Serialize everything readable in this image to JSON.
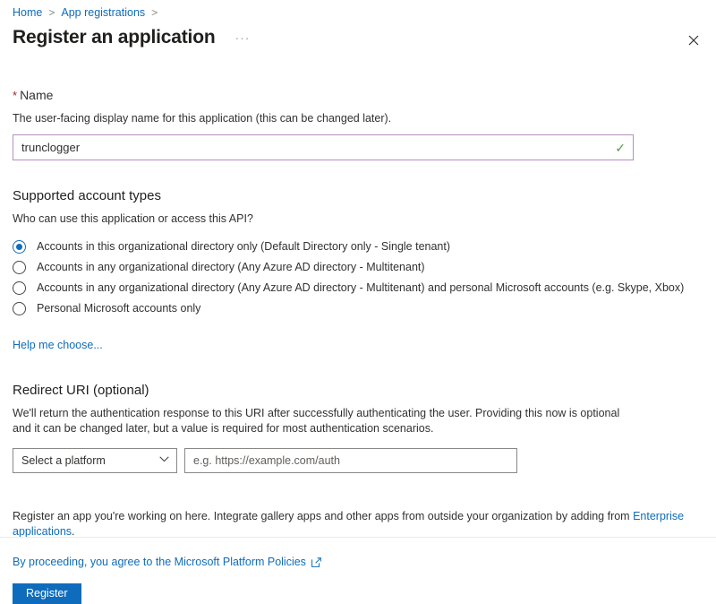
{
  "breadcrumb": {
    "items": [
      {
        "label": "Home"
      },
      {
        "label": "App registrations"
      }
    ],
    "separator": ">"
  },
  "header": {
    "title": "Register an application",
    "more_actions": "···",
    "close_label": "✕"
  },
  "name_section": {
    "required_marker": "*",
    "label": "Name",
    "description": "The user-facing display name for this application (this can be changed later).",
    "value": "trunclogger",
    "placeholder": "",
    "validation_icon": "✓",
    "validation_color": "#4f9e4f",
    "border_color": "#b58ec0"
  },
  "account_types": {
    "heading": "Supported account types",
    "description": "Who can use this application or access this API?",
    "options": [
      {
        "label": "Accounts in this organizational directory only (Default Directory only - Single tenant)",
        "selected": true
      },
      {
        "label": "Accounts in any organizational directory (Any Azure AD directory - Multitenant)",
        "selected": false
      },
      {
        "label": "Accounts in any organizational directory (Any Azure AD directory - Multitenant) and personal Microsoft accounts (e.g. Skype, Xbox)",
        "selected": false
      },
      {
        "label": "Personal Microsoft accounts only",
        "selected": false
      }
    ],
    "help_link": "Help me choose..."
  },
  "redirect_uri": {
    "heading": "Redirect URI (optional)",
    "description": "We'll return the authentication response to this URI after successfully authenticating the user. Providing this now is optional and it can be changed later, but a value is required for most authentication scenarios.",
    "platform_select": {
      "value": "Select a platform",
      "chevron": "⌄"
    },
    "uri_input": {
      "value": "",
      "placeholder": "e.g. https://example.com/auth"
    }
  },
  "footer": {
    "note_prefix": "Register an app you're working on here. Integrate gallery apps and other apps from outside your organization by adding from ",
    "note_link": "Enterprise applications",
    "note_suffix": ".",
    "policy_text": "By proceeding, you agree to the Microsoft Platform Policies",
    "submit_label": "Register"
  },
  "colors": {
    "link": "#0f6cbd",
    "primary_button": "#0f6cbd",
    "required": "#a4262c",
    "divider": "#edebe9"
  }
}
